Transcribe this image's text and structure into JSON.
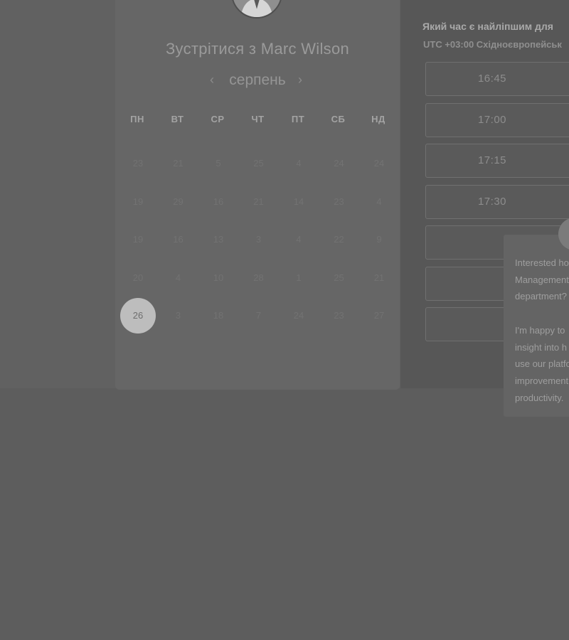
{
  "card": {
    "title": "Зустрітися з Marc Wilson",
    "month": "серпень",
    "prev_icon": "‹",
    "next_icon": "›",
    "weekdays": [
      "ПН",
      "ВТ",
      "СР",
      "ЧТ",
      "ПТ",
      "СБ",
      "НД"
    ],
    "weeks": [
      [
        "23",
        "21",
        "5",
        "25",
        "4",
        "24",
        "24"
      ],
      [
        "19",
        "29",
        "16",
        "21",
        "14",
        "23",
        "4"
      ],
      [
        "19",
        "16",
        "13",
        "3",
        "4",
        "22",
        "9"
      ],
      [
        "20",
        "4",
        "10",
        "28",
        "1",
        "25",
        "21"
      ],
      [
        "26",
        "3",
        "18",
        "7",
        "24",
        "23",
        "27"
      ]
    ],
    "selected_day": "26"
  },
  "times": {
    "title": "Який час є найліпшим для",
    "timezone": "UTC +03:00 Східноєвропейськ",
    "slots": [
      "16:45",
      "17:00",
      "17:15",
      "17:30",
      "",
      "",
      ""
    ]
  },
  "chat": {
    "message": "Interested how\nManagement\ndepartment?\n\nI'm happy to\ninsight into h\nuse our platfo\nimprovement\nproductivity."
  },
  "colors": {
    "overlay": "#616161",
    "selected_day": "#bdbdbd"
  }
}
